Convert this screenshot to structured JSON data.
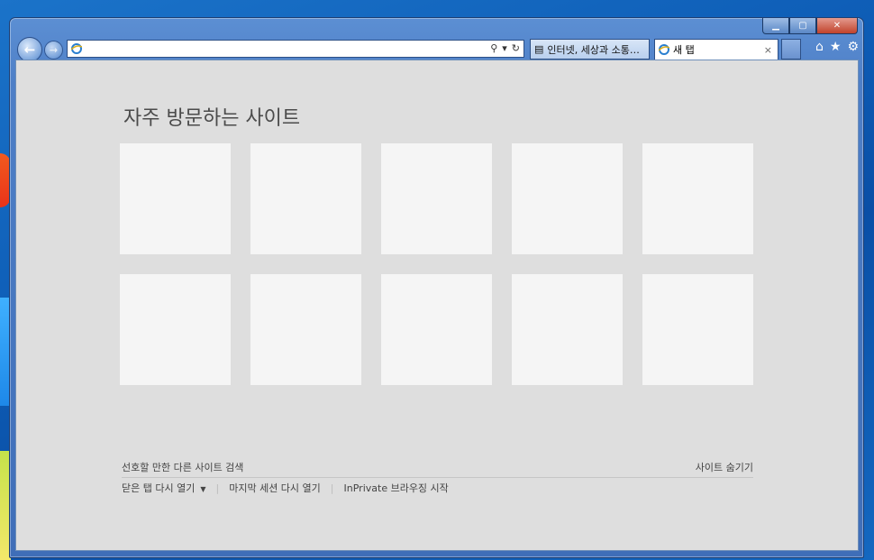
{
  "window": {
    "caption_buttons": {
      "minimize_icon": "minimize-icon",
      "maximize_icon": "maximize-icon",
      "close_icon": "close-icon"
    }
  },
  "navbar": {
    "address_value": "",
    "address_placeholder": "",
    "tabs": [
      {
        "label": "인터넷, 세상과 소통하...",
        "icon": "page-icon"
      },
      {
        "label": "새 탭",
        "icon": "ie-icon",
        "close": "×"
      }
    ],
    "icons": {
      "home": "⌂",
      "favorites": "★",
      "tools": "⚙"
    }
  },
  "newtab": {
    "title": "자주 방문하는 사이트",
    "tiles": [
      "",
      "",
      "",
      "",
      "",
      "",
      "",
      "",
      "",
      ""
    ],
    "discover_link": "선호할 만한 다른 사이트 검색",
    "hide_sites": "사이트 숨기기",
    "reopen_closed": "닫은 탭 다시 열기",
    "reopen_session": "마지막 세션 다시 열기",
    "inprivate": "InPrivate 브라우징 시작"
  }
}
